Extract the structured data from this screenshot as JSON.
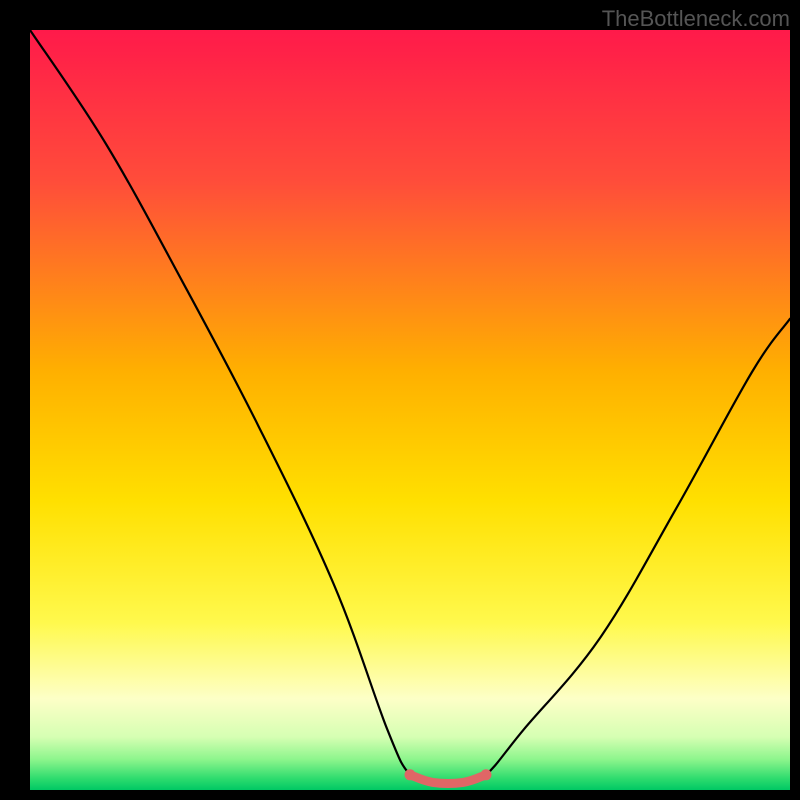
{
  "watermark": "TheBottleneck.com",
  "chart_data": {
    "type": "line",
    "title": "",
    "xlabel": "",
    "ylabel": "",
    "xlim": [
      0,
      100
    ],
    "ylim": [
      0,
      100
    ],
    "series": [
      {
        "name": "bottleneck_curve",
        "x": [
          0,
          10,
          20,
          30,
          40,
          47,
          50,
          53,
          57,
          60,
          65,
          75,
          85,
          95,
          100
        ],
        "values": [
          100,
          85,
          67,
          48,
          27,
          8,
          2,
          1,
          1,
          2,
          8,
          20,
          37,
          55,
          62
        ]
      }
    ],
    "highlight": {
      "name": "optimal_zone",
      "x": [
        50,
        53,
        57,
        60
      ],
      "values": [
        2,
        1,
        1,
        2
      ],
      "color": "#e06666"
    },
    "gradient_stops": [
      {
        "offset": 0.0,
        "color": "#ff1a4a"
      },
      {
        "offset": 0.2,
        "color": "#ff4d3a"
      },
      {
        "offset": 0.45,
        "color": "#ffb000"
      },
      {
        "offset": 0.62,
        "color": "#ffe000"
      },
      {
        "offset": 0.78,
        "color": "#fff94d"
      },
      {
        "offset": 0.88,
        "color": "#fdffc7"
      },
      {
        "offset": 0.93,
        "color": "#d6ffb3"
      },
      {
        "offset": 0.96,
        "color": "#8cf58c"
      },
      {
        "offset": 0.985,
        "color": "#2edc6e"
      },
      {
        "offset": 1.0,
        "color": "#00c864"
      }
    ]
  }
}
